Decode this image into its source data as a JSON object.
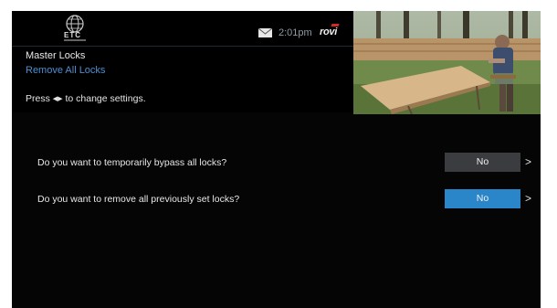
{
  "header": {
    "logo_text": "ETC",
    "time": "2:01pm",
    "brand": "rovi",
    "mail_icon": "envelope-icon"
  },
  "menu": {
    "title": "Master Locks",
    "subtitle": "Remove All Locks",
    "instruction_prefix": "Press",
    "instruction_arrows": "◀▶",
    "instruction_suffix": "to change settings."
  },
  "questions": [
    {
      "label": "Do you want to temporarily bypass all locks?",
      "value": "No",
      "selected": false
    },
    {
      "label": "Do you want to remove all previously set locks?",
      "value": "No",
      "selected": true
    }
  ],
  "colors": {
    "background": "#050505",
    "accent": "#2a85c9",
    "button_default": "#3a3c40",
    "subtitle": "#4d8fd0"
  }
}
